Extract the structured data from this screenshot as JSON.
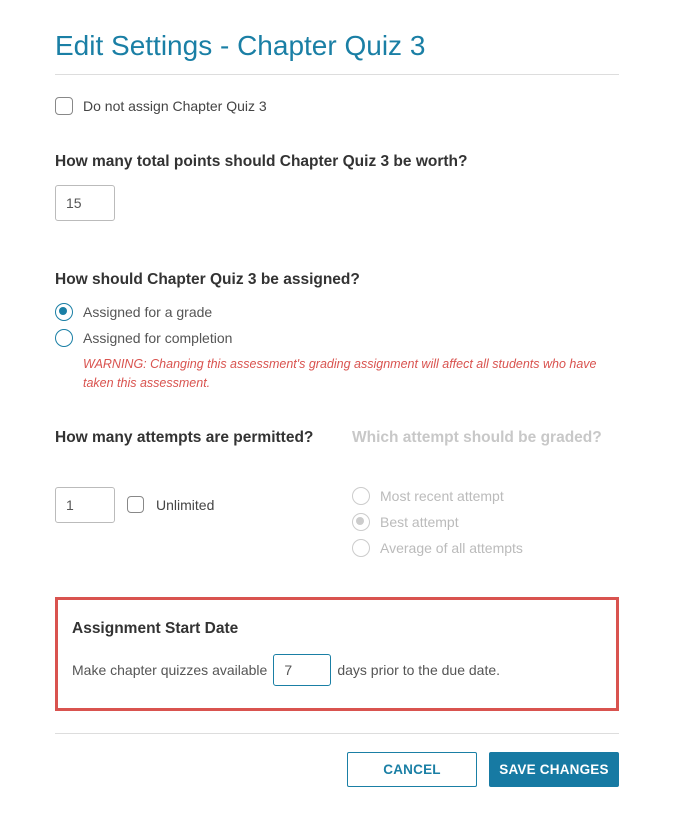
{
  "title": "Edit Settings - Chapter Quiz 3",
  "doNotAssign": {
    "checked": false,
    "label": "Do not assign Chapter Quiz 3"
  },
  "points": {
    "heading": "How many total points should Chapter Quiz 3 be worth?",
    "value": "15"
  },
  "assignMode": {
    "heading": "How should Chapter Quiz 3 be assigned?",
    "options": {
      "grade": "Assigned for a grade",
      "completion": "Assigned for completion"
    },
    "selected": "grade",
    "warning": "WARNING: Changing this assessment's grading assignment will affect all students who have taken this assessment."
  },
  "attempts": {
    "heading": "How many attempts are permitted?",
    "value": "1",
    "unlimitedLabel": "Unlimited",
    "unlimitedChecked": false
  },
  "gradedAttempt": {
    "heading": "Which attempt should be graded?",
    "options": {
      "recent": "Most recent attempt",
      "best": "Best attempt",
      "average": "Average of all attempts"
    },
    "selected": "best",
    "disabled": true
  },
  "startDate": {
    "heading": "Assignment Start Date",
    "pre": "Make chapter quizzes available",
    "value": "7",
    "post": "days prior to the due date."
  },
  "buttons": {
    "cancel": "CANCEL",
    "save": "SAVE CHANGES"
  }
}
